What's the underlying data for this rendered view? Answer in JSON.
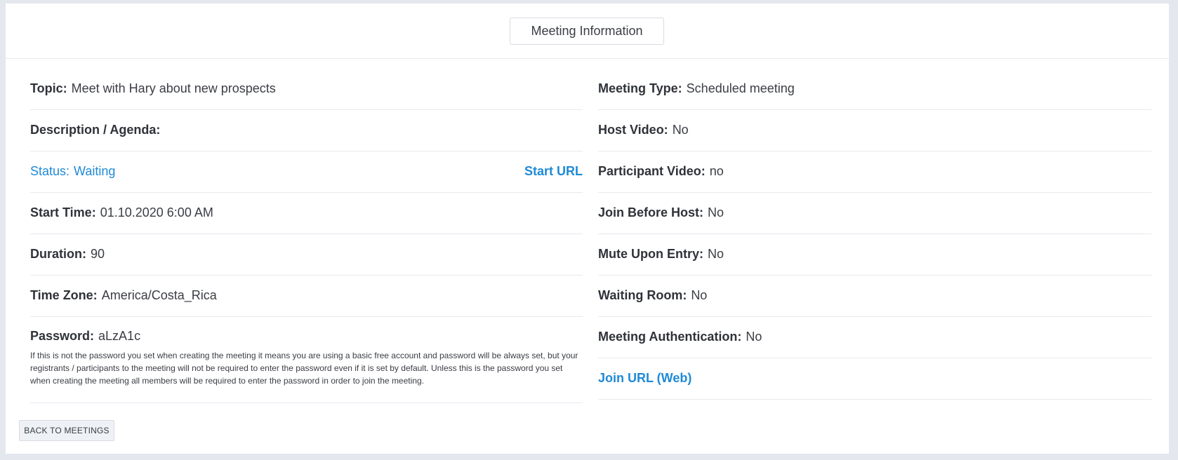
{
  "header": {
    "title": "Meeting Information"
  },
  "left": {
    "topic": {
      "label": "Topic:",
      "value": "Meet with Hary about new prospects"
    },
    "description": {
      "label": "Description / Agenda:",
      "value": ""
    },
    "status": {
      "label": "Status:",
      "value": "Waiting",
      "start_url": "Start URL"
    },
    "start_time": {
      "label": "Start Time:",
      "value": "01.10.2020 6:00 AM"
    },
    "duration": {
      "label": "Duration:",
      "value": "90"
    },
    "time_zone": {
      "label": "Time Zone:",
      "value": "America/Costa_Rica"
    },
    "password": {
      "label": "Password:",
      "value": "aLzA1c",
      "note": "If this is not the password you set when creating the meeting it means you are using a basic free account and password will be always set, but your registrants / participants to the meeting will not be required to enter the password even if it is set by default. Unless this is the password you set when creating the meeting all members will be required to enter the password in order to join the meeting."
    }
  },
  "right": {
    "meeting_type": {
      "label": "Meeting Type:",
      "value": "Scheduled meeting"
    },
    "host_video": {
      "label": "Host Video:",
      "value": "No"
    },
    "participant_video": {
      "label": "Participant Video:",
      "value": "no"
    },
    "join_before_host": {
      "label": "Join Before Host:",
      "value": "No"
    },
    "mute_upon_entry": {
      "label": "Mute Upon Entry:",
      "value": "No"
    },
    "waiting_room": {
      "label": "Waiting Room:",
      "value": "No"
    },
    "meeting_authentication": {
      "label": "Meeting Authentication:",
      "value": "No"
    },
    "join_url": {
      "label": "Join URL (Web)"
    }
  },
  "footer": {
    "back_label": "BACK TO MEETINGS"
  },
  "colors": {
    "accent": "#1f8ad6",
    "background": "#e4e7ee",
    "divider": "#e6e9ee"
  }
}
